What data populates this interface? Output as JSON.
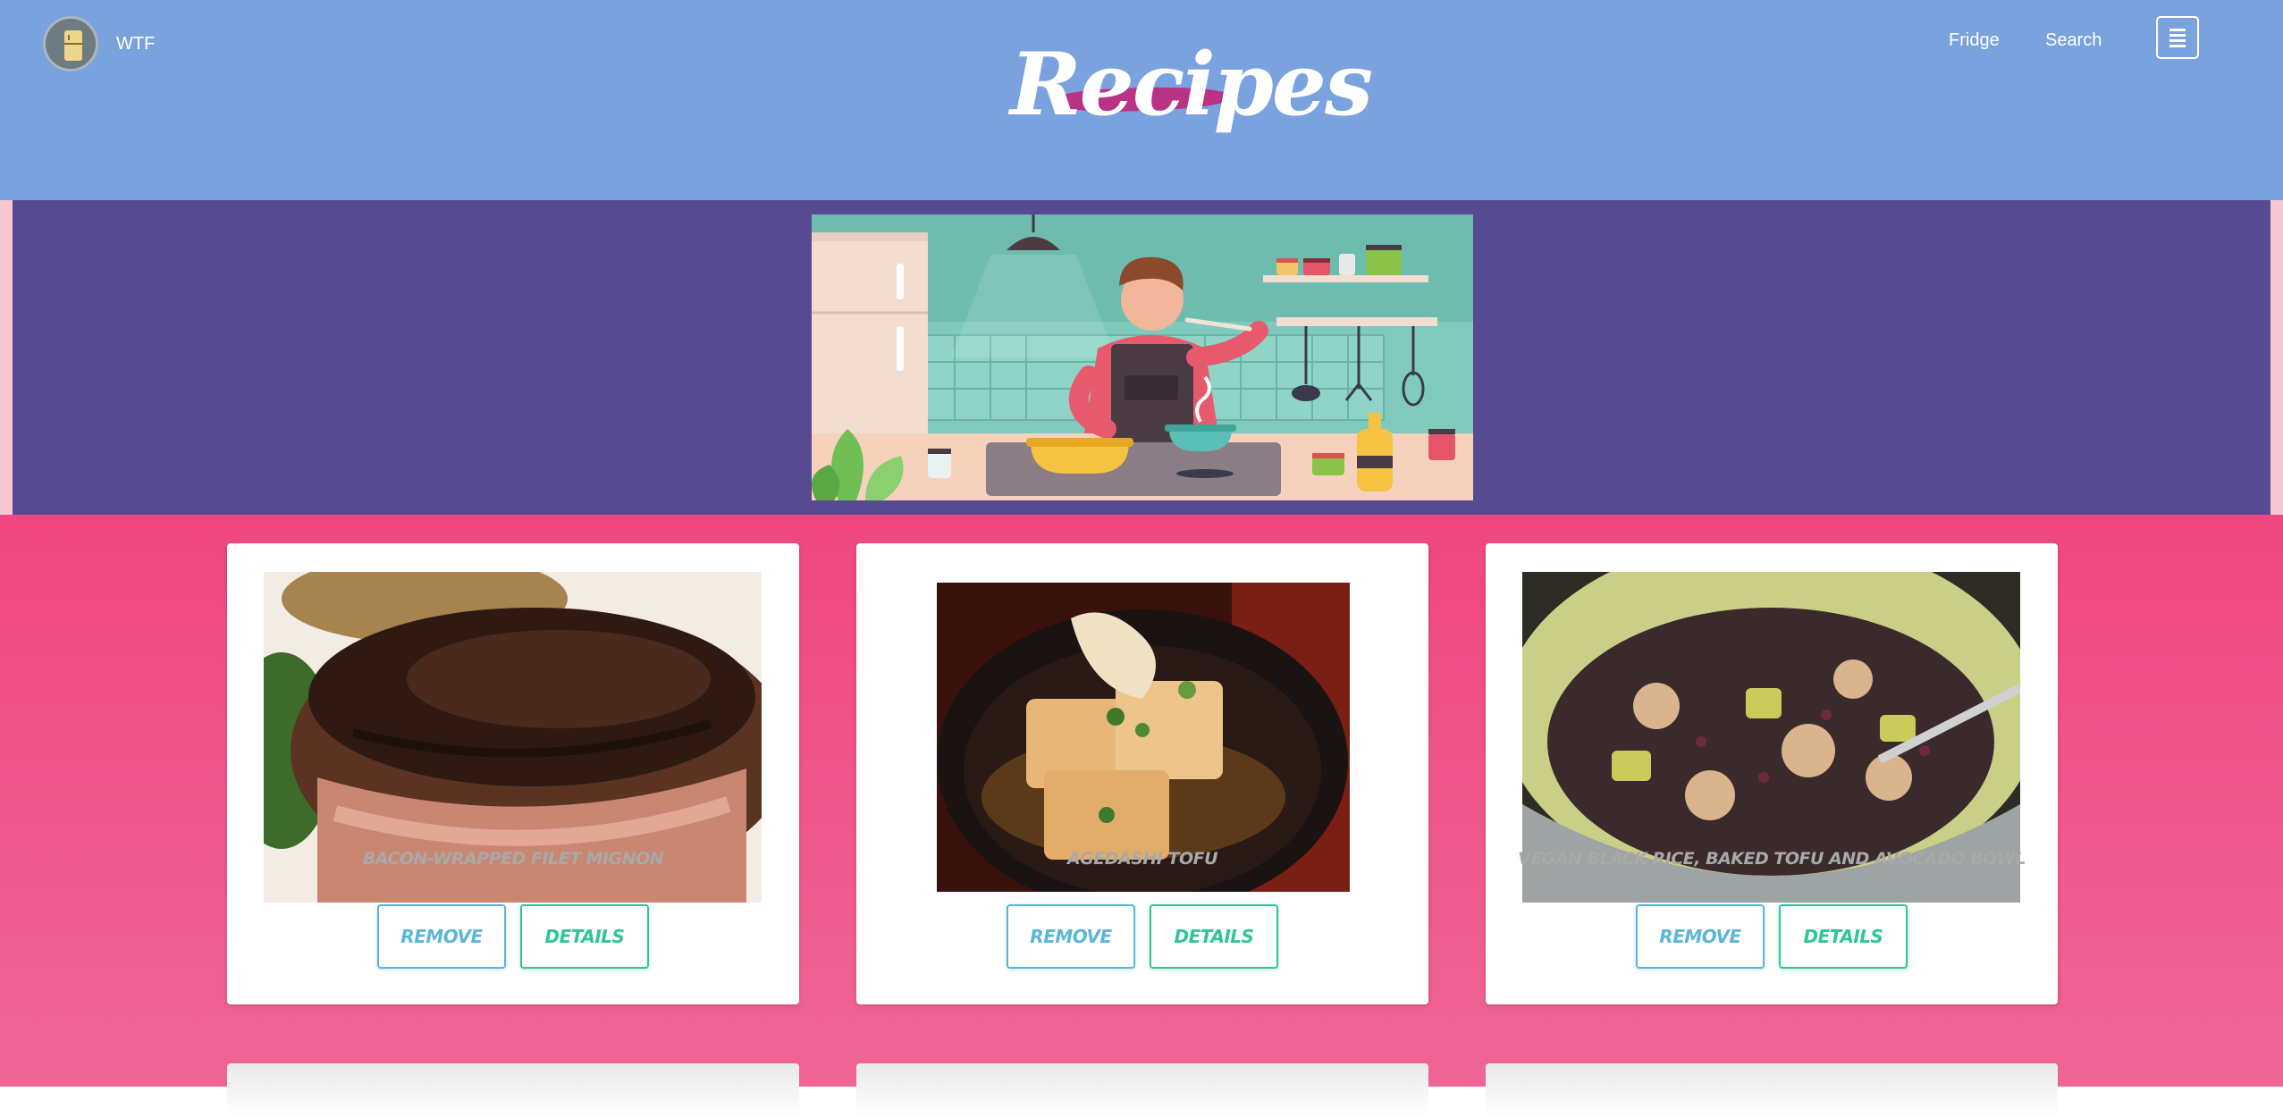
{
  "header": {
    "brand_name": "WTF",
    "brand_icon": "fridge-icon",
    "title": "Recipes",
    "nav": [
      {
        "label": "Fridge"
      },
      {
        "label": "Search"
      }
    ],
    "menu_icon": "hamburger-menu-icon"
  },
  "hero": {
    "image": "chef-tasting-illustration"
  },
  "recipes": [
    {
      "title": "Bacon-Wrapped Filet Mignon",
      "image": "bacon-wrapped-filet-photo",
      "remove_label": "Remove",
      "details_label": "Details"
    },
    {
      "title": "Agedashi Tofu",
      "image": "agedashi-tofu-photo",
      "remove_label": "Remove",
      "details_label": "Details"
    },
    {
      "title": "Vegan Black Rice, Baked Tofu and Avocado Bowl",
      "image": "black-rice-bowl-photo",
      "remove_label": "Remove",
      "details_label": "Details"
    }
  ],
  "colors": {
    "header_bg": "#7aa2de",
    "hero_bg": "#564a91",
    "content_bg": "#ef4780",
    "remove_accent": "#5bb6d8",
    "details_accent": "#2fc59a"
  }
}
